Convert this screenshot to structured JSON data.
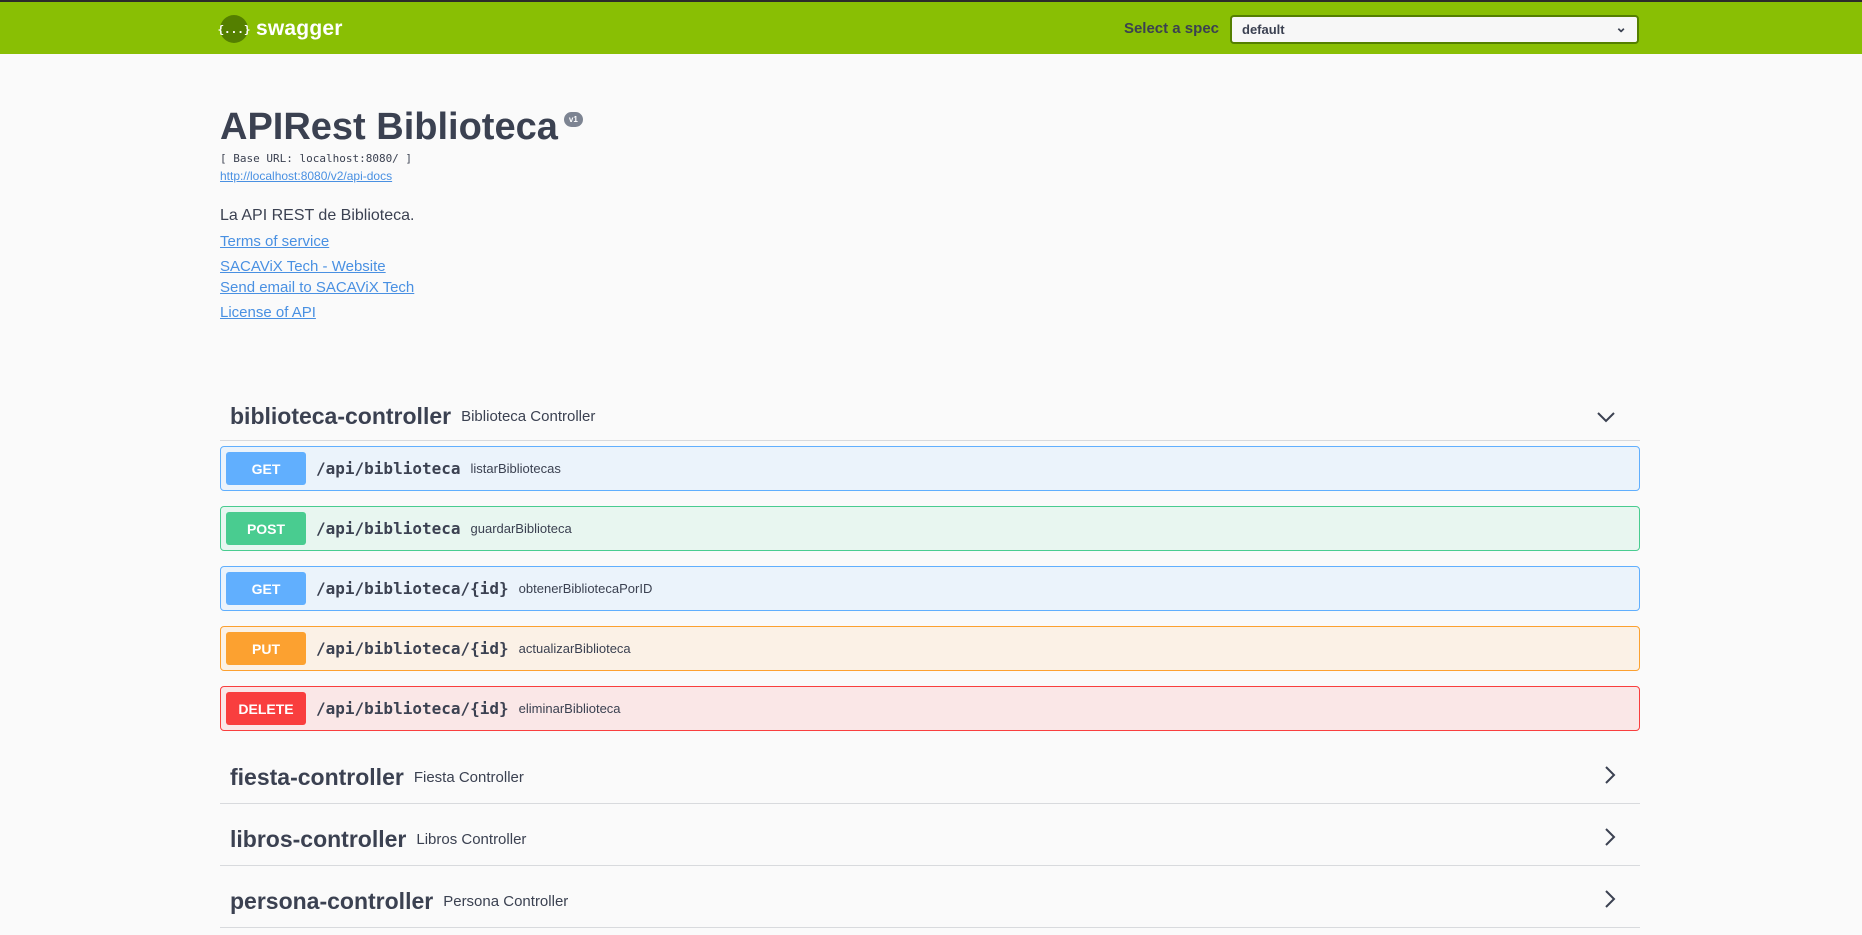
{
  "topbar": {
    "logo_mark": "{...}",
    "logo_text": "swagger",
    "spec_label": "Select a spec",
    "spec_value": "default"
  },
  "info": {
    "title": "APIRest Biblioteca",
    "version": "v1",
    "base_url": "[ Base URL: localhost:8080/ ]",
    "api_docs_link": "http://localhost:8080/v2/api-docs",
    "description": "La API REST de Biblioteca.",
    "terms": "Terms of service",
    "website": "SACAViX Tech - Website",
    "email": "Send email to SACAViX Tech",
    "license": "License of API"
  },
  "controllers": [
    {
      "name": "biblioteca-controller",
      "desc": "Biblioteca Controller",
      "expanded": true
    },
    {
      "name": "fiesta-controller",
      "desc": "Fiesta Controller",
      "expanded": false
    },
    {
      "name": "libros-controller",
      "desc": "Libros Controller",
      "expanded": false
    },
    {
      "name": "persona-controller",
      "desc": "Persona Controller",
      "expanded": false
    }
  ],
  "operations": [
    {
      "method": "GET",
      "path": "/api/biblioteca",
      "summary": "listarBibliotecas"
    },
    {
      "method": "POST",
      "path": "/api/biblioteca",
      "summary": "guardarBiblioteca"
    },
    {
      "method": "GET",
      "path": "/api/biblioteca/{id}",
      "summary": "obtenerBibliotecaPorID"
    },
    {
      "method": "PUT",
      "path": "/api/biblioteca/{id}",
      "summary": "actualizarBiblioteca"
    },
    {
      "method": "DELETE",
      "path": "/api/biblioteca/{id}",
      "summary": "eliminarBiblioteca"
    }
  ],
  "colors": {
    "topbar": "#89bf04",
    "get": "#61affe",
    "post": "#49cc90",
    "put": "#fca130",
    "delete": "#f93e3e"
  }
}
